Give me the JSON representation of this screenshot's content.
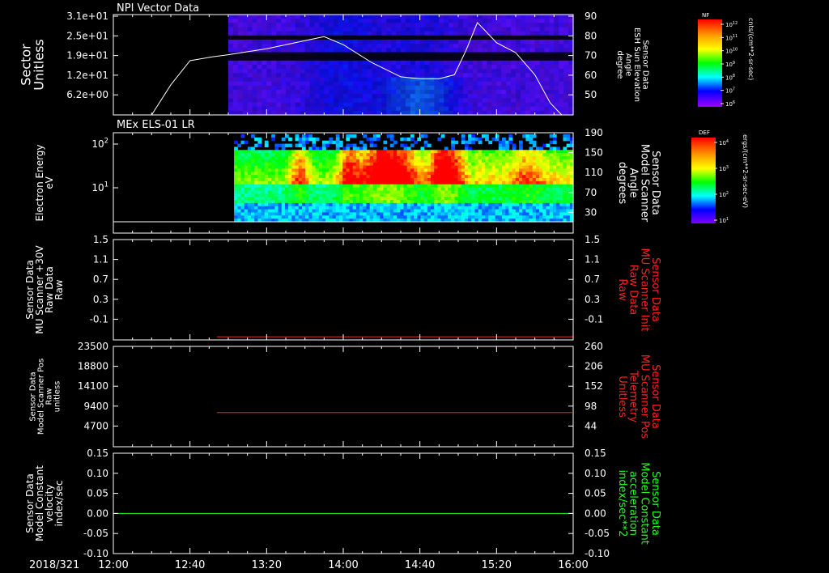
{
  "date_label": "2018/321",
  "time_axis": {
    "start_min": 0,
    "end_min": 240,
    "tick_labels": [
      "12:00",
      "12:40",
      "13:20",
      "14:00",
      "14:40",
      "15:20",
      "16:00"
    ]
  },
  "colorbars": [
    {
      "title": "NF",
      "unit": "cnts/(cm**2-sr-sec)",
      "ticks": [
        "10^12",
        "10^11",
        "10^10",
        "10^9",
        "10^8",
        "10^7",
        "10^6"
      ]
    },
    {
      "title": "DEF",
      "unit": "ergs/(cm**2-sr-sec-eV)",
      "ticks": [
        "10^4",
        "10^3",
        "10^2",
        "10^1"
      ]
    }
  ],
  "colors": {
    "axis": "#ffffff",
    "red_series": "#ff2020",
    "green_series": "#20ff20",
    "white_series": "#ffffff"
  },
  "chart_data": [
    {
      "type": "heatmap",
      "panel_title": "NPI Vector Data",
      "ylabel_left": [
        "Sector",
        "Unitless"
      ],
      "yticks_left": [
        "3.1e+01",
        "2.5e+01",
        "1.9e+01",
        "1.2e+01",
        "6.2e+00"
      ],
      "ylabel_right": [
        "Sensor Data",
        "ESH Sun Elevation",
        "Angle",
        "degree"
      ],
      "yticks_right": [
        "90",
        "80",
        "70",
        "60",
        "50"
      ],
      "data_start_min": 60,
      "overlay_line": {
        "name": "ESH Sun Elevation Angle",
        "x_min": [
          0,
          20,
          30,
          40,
          52,
          60,
          80,
          100,
          110,
          120,
          135,
          150,
          160,
          170,
          178,
          184,
          190,
          200,
          210,
          220,
          228,
          234
        ],
        "y": [
          40,
          40,
          55,
          67,
          69,
          70,
          73,
          77,
          79,
          75,
          66,
          59,
          58,
          58,
          60,
          72,
          86,
          76,
          71,
          60,
          46,
          40
        ],
        "range": [
          40,
          90
        ]
      }
    },
    {
      "type": "heatmap",
      "panel_title": "MEx ELS-01 LR",
      "ylabel_left": [
        "Electron Energy",
        "eV"
      ],
      "yticks_left": [
        "10^2",
        "10^1"
      ],
      "ylabel_right": [
        "Sensor Data",
        "Model Scanner",
        "Angle",
        "degrees"
      ],
      "yticks_right": [
        "190",
        "150",
        "110",
        "70",
        "30"
      ],
      "data_start_min": 63
    },
    {
      "type": "line",
      "ylabel_left": [
        "Sensor Data",
        "MU Scanner +30V",
        "Raw Data",
        "Raw"
      ],
      "yticks_left": [
        "1.5",
        "1.1",
        "0.7",
        "0.3",
        "-0.1"
      ],
      "ylabel_right": [
        "Sensor Data",
        "MU Scanner Init",
        "Raw Data",
        "Raw"
      ],
      "yticks_right": [
        "1.5",
        "1.1",
        "0.7",
        "0.3",
        "-0.1"
      ],
      "ylim": [
        -0.1,
        1.5
      ],
      "series": [
        {
          "color": "red",
          "x_min": [
            54,
            240
          ],
          "values": [
            -0.05,
            -0.05
          ]
        }
      ]
    },
    {
      "type": "line",
      "ylabel_left": [
        "Sensor Data",
        "Model Scanner Pos",
        "Raw",
        "unitless"
      ],
      "yticks_left": [
        "23500",
        "18800",
        "14100",
        "9400",
        "4700"
      ],
      "ylabel_right": [
        "Sensor Data",
        "MU Scanner Pos",
        "Telemetry",
        "Unitless"
      ],
      "yticks_right": [
        "260",
        "206",
        "152",
        "98",
        "44"
      ],
      "ylim": [
        0,
        23500
      ],
      "series": [
        {
          "color": "red",
          "x_min": [
            54,
            240
          ],
          "values": [
            8000,
            8000
          ]
        }
      ]
    },
    {
      "type": "line",
      "ylabel_left": [
        "Sensor Data",
        "Model Constant",
        "velocity",
        "index/sec"
      ],
      "yticks_left": [
        "0.15",
        "0.10",
        "0.05",
        "0.00",
        "-0.05",
        "-0.10"
      ],
      "ylabel_right": [
        "Sensor Data",
        "Model Constant",
        "acceleration",
        "index/sec**2"
      ],
      "yticks_right": [
        "0.15",
        "0.10",
        "0.05",
        "0.00",
        "-0.05",
        "-0.10"
      ],
      "ylim": [
        -0.1,
        0.15
      ],
      "series": [
        {
          "color": "green",
          "x_min": [
            0,
            240
          ],
          "values": [
            0.0,
            0.0
          ]
        }
      ]
    }
  ]
}
